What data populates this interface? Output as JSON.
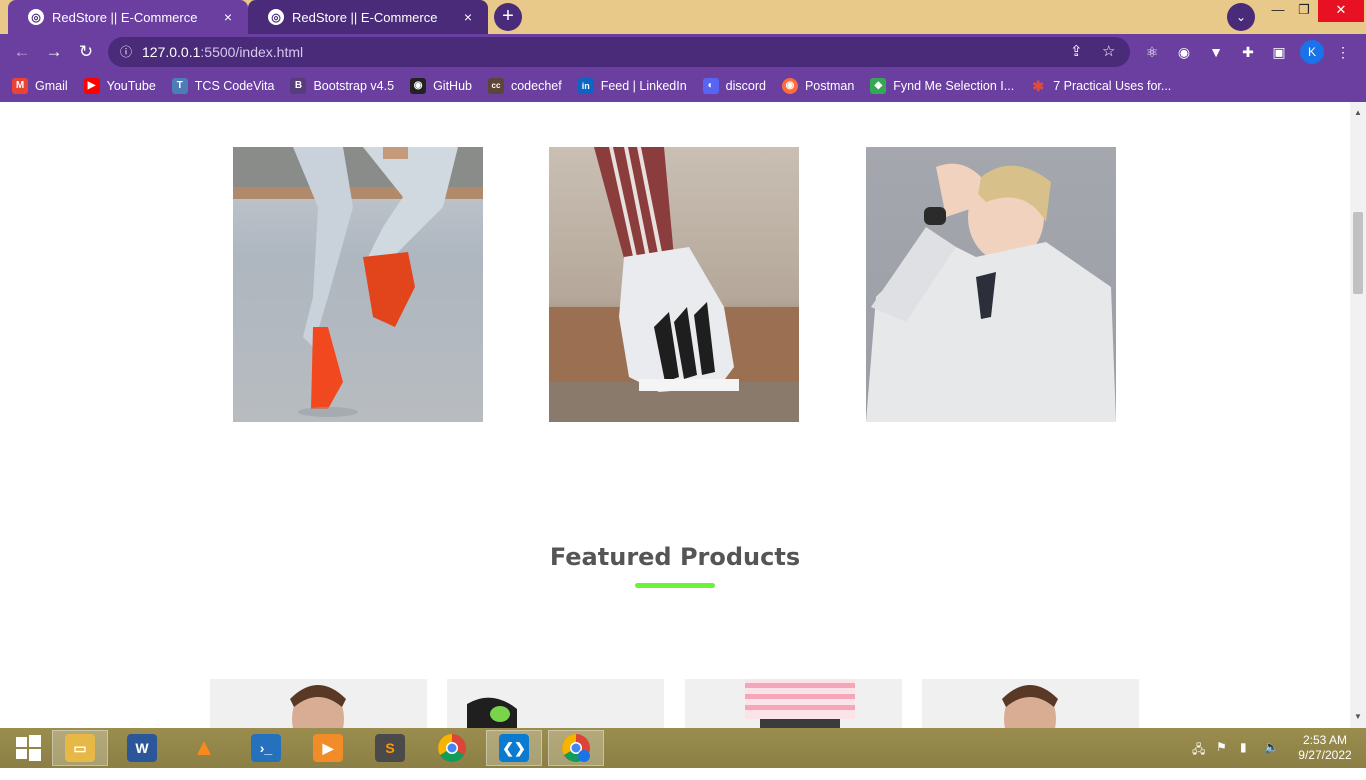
{
  "browser": {
    "tabs": [
      {
        "title": "RedStore || E-Commerce",
        "close": "×"
      },
      {
        "title": "RedStore || E-Commerce",
        "close": "×"
      }
    ],
    "new_tab": "+",
    "tab_search": "⌄",
    "window": {
      "minimize": "—",
      "restore": "❐",
      "close": "✕"
    },
    "nav": {
      "back": "←",
      "forward": "→",
      "reload": "↻"
    },
    "address": {
      "host": "127.0.0.1",
      "path": ":5500/index.html",
      "info": "ⓘ"
    },
    "profile_initial": "K",
    "bookmarks": [
      {
        "label": "Gmail",
        "icon": "M",
        "color": "#ea4335"
      },
      {
        "label": "YouTube",
        "icon": "▶",
        "color": "#ff0000"
      },
      {
        "label": "TCS CodeVita",
        "icon": "T",
        "color": "#4c7db5"
      },
      {
        "label": "Bootstrap v4.5",
        "icon": "B",
        "color": "#563d7c"
      },
      {
        "label": "GitHub",
        "icon": "◉",
        "color": "#222222"
      },
      {
        "label": "codechef",
        "icon": "cc",
        "color": "#5b4638"
      },
      {
        "label": "Feed | LinkedIn",
        "icon": "in",
        "color": "#0a66c2"
      },
      {
        "label": "discord",
        "icon": "◐",
        "color": "#5865f2"
      },
      {
        "label": "Postman",
        "icon": "◉",
        "color": "#ff6c37"
      },
      {
        "label": "Fynd Me Selection I...",
        "icon": "◆",
        "color": "#34a853"
      },
      {
        "label": "7 Practical Uses for...",
        "icon": "✱",
        "color": "#e04b3a"
      }
    ]
  },
  "page": {
    "categories": [
      {
        "name": "category-1"
      },
      {
        "name": "category-2"
      },
      {
        "name": "category-3"
      }
    ],
    "featured_title": "Featured Products",
    "accent": "#6cf23a"
  },
  "taskbar": {
    "time": "2:53 AM",
    "date": "9/27/2022"
  }
}
